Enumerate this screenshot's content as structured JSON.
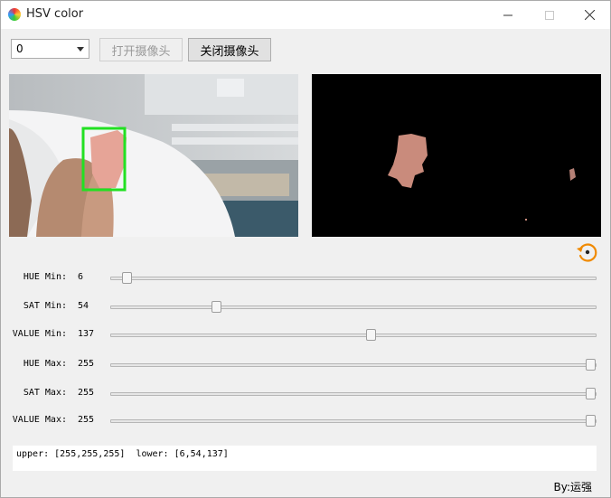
{
  "window": {
    "title": "HSV color",
    "controls": {
      "minimize": "minimize-icon",
      "maximize": "maximize-icon",
      "close": "close-icon"
    }
  },
  "toolbar": {
    "camera_select": {
      "value": "0"
    },
    "open_camera_label": "打开摄像头",
    "close_camera_label": "关闭摄像头"
  },
  "sliders": [
    {
      "label": "HUE Min:",
      "value": "6",
      "fraction": 0.0235
    },
    {
      "label": "SAT Min:",
      "value": "54",
      "fraction": 0.2118
    },
    {
      "label": "VALUE Min:",
      "value": "137",
      "fraction": 0.5373
    },
    {
      "label": "HUE Max:",
      "value": "255",
      "fraction": 1.0
    },
    {
      "label": "SAT Max:",
      "value": "255",
      "fraction": 1.0
    },
    {
      "label": "VALUE Max:",
      "value": "255",
      "fraction": 1.0
    }
  ],
  "output_text": "upper: [255,255,255]  lower: [6,54,137]",
  "credit": "By:运强",
  "colors": {
    "accent_orange": "#f08a00",
    "detect_box": "#22e022",
    "blob": "#c98b7c"
  }
}
